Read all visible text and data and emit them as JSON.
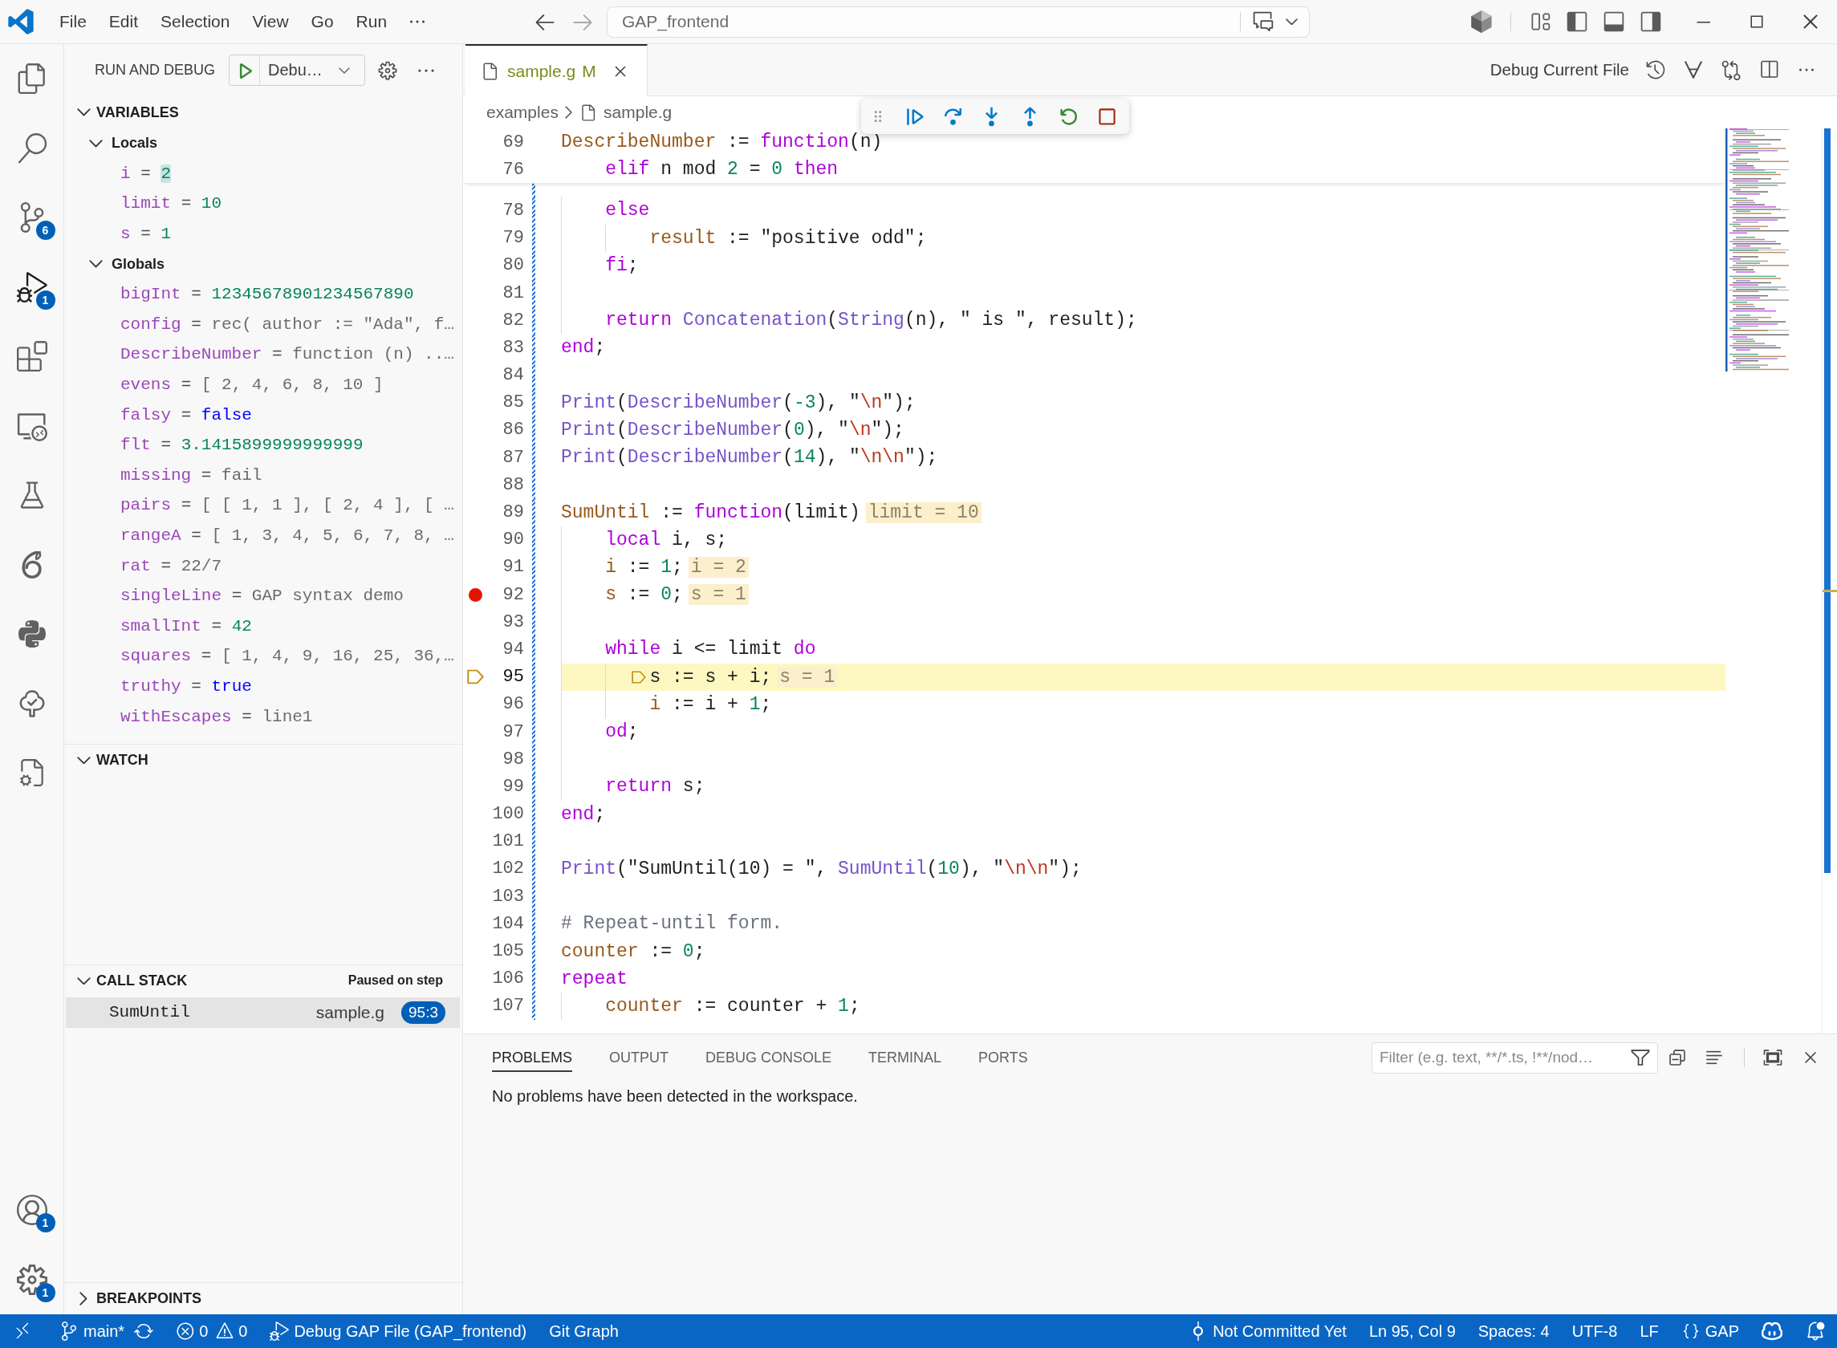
{
  "title_bar": {
    "menu": [
      {
        "label": "File"
      },
      {
        "label": "Edit"
      },
      {
        "label": "Selection"
      },
      {
        "label": "View"
      },
      {
        "label": "Go"
      },
      {
        "label": "Run"
      }
    ],
    "command_center": {
      "value": "GAP_frontend"
    }
  },
  "activity_bar": {
    "items": [
      {
        "selected": false
      },
      {
        "selected": false
      },
      {
        "selected": false,
        "badge": "6"
      },
      {
        "selected": true,
        "badge": "1"
      },
      {
        "selected": false
      },
      {
        "selected": false
      },
      {
        "selected": false
      },
      {
        "selected": false
      },
      {
        "selected": false
      },
      {
        "selected": false
      },
      {
        "selected": false
      }
    ],
    "bottom": [
      {
        "badge": "1"
      },
      {
        "badge": "1"
      }
    ]
  },
  "sidebar": {
    "title": "RUN AND DEBUG",
    "configuration": "Debu…",
    "variables": {
      "title": "VARIABLES",
      "expanded": true,
      "scopes": [
        {
          "name": "Locals",
          "expanded": true,
          "items": [
            {
              "name": "i",
              "separator": "=",
              "value": "2",
              "kind": "number",
              "changed": true
            },
            {
              "name": "limit",
              "separator": "=",
              "value": "10",
              "kind": "number",
              "changed": false
            },
            {
              "name": "s",
              "separator": "=",
              "value": "1",
              "kind": "number",
              "changed": false
            }
          ]
        },
        {
          "name": "Globals",
          "expanded": true,
          "items": [
            {
              "name": "bigInt",
              "separator": "=",
              "value": "12345678901234567890",
              "kind": "number",
              "changed": false
            },
            {
              "name": "config",
              "separator": "=",
              "value": "rec( author := \"Ada\", f…",
              "kind": "text",
              "changed": false
            },
            {
              "name": "DescribeNumber",
              "separator": "=",
              "value": "function (n) ..…",
              "kind": "text",
              "changed": false
            },
            {
              "name": "evens",
              "separator": "=",
              "value": "[ 2, 4, 6, 8, 10 ]",
              "kind": "text",
              "changed": false
            },
            {
              "name": "falsy",
              "separator": "=",
              "value": "false",
              "kind": "boolean",
              "changed": false
            },
            {
              "name": "flt",
              "separator": "=",
              "value": "3.1415899999999999",
              "kind": "number",
              "changed": false
            },
            {
              "name": "missing",
              "separator": "=",
              "value": "fail",
              "kind": "text",
              "changed": false
            },
            {
              "name": "pairs",
              "separator": "=",
              "value": "[ [ 1, 1 ], [ 2, 4 ], [ …",
              "kind": "text",
              "changed": false
            },
            {
              "name": "rangeA",
              "separator": "=",
              "value": "[ 1, 3, 4, 5, 6, 7, 8, …",
              "kind": "text",
              "changed": false
            },
            {
              "name": "rat",
              "separator": "=",
              "value": "22/7",
              "kind": "text",
              "changed": false
            },
            {
              "name": "singleLine",
              "separator": "=",
              "value": "GAP syntax demo",
              "kind": "text",
              "changed": false
            },
            {
              "name": "smallInt",
              "separator": "=",
              "value": "42",
              "kind": "number",
              "changed": false
            },
            {
              "name": "squares",
              "separator": "=",
              "value": "[ 1, 4, 9, 16, 25, 36,…",
              "kind": "text",
              "changed": false
            },
            {
              "name": "truthy",
              "separator": "=",
              "value": "true",
              "kind": "boolean",
              "changed": false
            },
            {
              "name": "withEscapes",
              "separator": "=",
              "value": "line1",
              "kind": "text",
              "changed": false
            }
          ]
        }
      ]
    },
    "watch": {
      "title": "WATCH",
      "expanded": true
    },
    "call_stack": {
      "title": "CALL STACK",
      "expanded": true,
      "status": "Paused on step",
      "frames": [
        {
          "name": "SumUntil",
          "file": "sample.g",
          "position": "95:3",
          "selected": true
        }
      ]
    },
    "breakpoints": {
      "title": "BREAKPOINTS",
      "expanded": false
    }
  },
  "editor": {
    "tabs": [
      {
        "label": "sample.g",
        "status": "M",
        "selected": true
      }
    ],
    "debug_action": "Debug Current File",
    "breadcrumb": [
      "examples",
      "sample.g"
    ],
    "sticky_lines": [
      {
        "number": "69",
        "tokens": [
          {
            "kind": "definition",
            "text": "DescribeNumber"
          },
          {
            "kind": "plain",
            "text": " := "
          },
          {
            "kind": "keyword",
            "text": "function"
          },
          {
            "kind": "plain",
            "text": "(n)"
          }
        ]
      },
      {
        "number": "76",
        "tokens": [
          {
            "kind": "keyword",
            "text": "    elif"
          },
          {
            "kind": "plain",
            "text": " n mod "
          },
          {
            "kind": "number",
            "text": "2"
          },
          {
            "kind": "plain",
            "text": " = "
          },
          {
            "kind": "number",
            "text": "0"
          },
          {
            "kind": "keyword",
            "text": " then"
          }
        ]
      }
    ],
    "lines": [
      {
        "number": "78",
        "tokens": [
          {
            "kind": "keyword",
            "text": "    else"
          }
        ],
        "added": true,
        "breakpoint": false,
        "current": false
      },
      {
        "number": "79",
        "tokens": [
          {
            "kind": "definition",
            "text": "        result"
          },
          {
            "kind": "plain",
            "text": " := \"positive odd\";"
          }
        ],
        "added": true,
        "breakpoint": false,
        "current": false
      },
      {
        "number": "80",
        "tokens": [
          {
            "kind": "keyword",
            "text": "    fi"
          },
          {
            "kind": "plain",
            "text": ";"
          }
        ],
        "added": true,
        "breakpoint": false,
        "current": false
      },
      {
        "number": "81",
        "added": true,
        "breakpoint": false,
        "current": false
      },
      {
        "number": "82",
        "tokens": [
          {
            "kind": "keyword",
            "text": "    return"
          },
          {
            "kind": "call",
            "text": " Concatenation"
          },
          {
            "kind": "plain",
            "text": "("
          },
          {
            "kind": "call",
            "text": "String"
          },
          {
            "kind": "plain",
            "text": "(n), \" is \", result);"
          }
        ],
        "added": true,
        "breakpoint": false,
        "current": false
      },
      {
        "number": "83",
        "tokens": [
          {
            "kind": "keyword",
            "text": "end"
          },
          {
            "kind": "plain",
            "text": ";"
          }
        ],
        "added": true,
        "breakpoint": false,
        "current": false
      },
      {
        "number": "84",
        "added": true,
        "breakpoint": false,
        "current": false
      },
      {
        "number": "85",
        "tokens": [
          {
            "kind": "call",
            "text": "Print"
          },
          {
            "kind": "plain",
            "text": "("
          },
          {
            "kind": "call",
            "text": "DescribeNumber"
          },
          {
            "kind": "plain",
            "text": "("
          },
          {
            "kind": "number",
            "text": "-3"
          },
          {
            "kind": "plain",
            "text": "), \""
          },
          {
            "kind": "escape",
            "text": "\\n"
          },
          {
            "kind": "plain",
            "text": "\");"
          }
        ],
        "added": true,
        "breakpoint": false,
        "current": false
      },
      {
        "number": "86",
        "tokens": [
          {
            "kind": "call",
            "text": "Print"
          },
          {
            "kind": "plain",
            "text": "("
          },
          {
            "kind": "call",
            "text": "DescribeNumber"
          },
          {
            "kind": "plain",
            "text": "("
          },
          {
            "kind": "number",
            "text": "0"
          },
          {
            "kind": "plain",
            "text": "), \""
          },
          {
            "kind": "escape",
            "text": "\\n"
          },
          {
            "kind": "plain",
            "text": "\");"
          }
        ],
        "added": true,
        "breakpoint": false,
        "current": false
      },
      {
        "number": "87",
        "tokens": [
          {
            "kind": "call",
            "text": "Print"
          },
          {
            "kind": "plain",
            "text": "("
          },
          {
            "kind": "call",
            "text": "DescribeNumber"
          },
          {
            "kind": "plain",
            "text": "("
          },
          {
            "kind": "number",
            "text": "14"
          },
          {
            "kind": "plain",
            "text": "), \""
          },
          {
            "kind": "escape",
            "text": "\\n\\n"
          },
          {
            "kind": "plain",
            "text": "\");"
          }
        ],
        "added": true,
        "breakpoint": false,
        "current": false
      },
      {
        "number": "88",
        "added": true,
        "breakpoint": false,
        "current": false
      },
      {
        "number": "89",
        "tokens": [
          {
            "kind": "definition",
            "text": "SumUntil"
          },
          {
            "kind": "plain",
            "text": " := "
          },
          {
            "kind": "keyword",
            "text": "function"
          },
          {
            "kind": "plain",
            "text": "(limit)"
          }
        ],
        "inline_value": "limit = 10",
        "added": true,
        "breakpoint": false,
        "current": false
      },
      {
        "number": "90",
        "tokens": [
          {
            "kind": "keyword",
            "text": "    local"
          },
          {
            "kind": "plain",
            "text": " i, s;"
          }
        ],
        "added": true,
        "breakpoint": false,
        "current": false
      },
      {
        "number": "91",
        "tokens": [
          {
            "kind": "definition",
            "text": "    i"
          },
          {
            "kind": "plain",
            "text": " := "
          },
          {
            "kind": "number",
            "text": "1"
          },
          {
            "kind": "plain",
            "text": ";"
          }
        ],
        "inline_value": "i = 2",
        "added": true,
        "breakpoint": false,
        "current": false
      },
      {
        "number": "92",
        "tokens": [
          {
            "kind": "definition",
            "text": "    s"
          },
          {
            "kind": "plain",
            "text": " := "
          },
          {
            "kind": "number",
            "text": "0"
          },
          {
            "kind": "plain",
            "text": ";"
          }
        ],
        "inline_value": "s = 1",
        "added": true,
        "breakpoint": true,
        "current": false
      },
      {
        "number": "93",
        "added": true,
        "breakpoint": false,
        "current": false
      },
      {
        "number": "94",
        "tokens": [
          {
            "kind": "keyword",
            "text": "    while"
          },
          {
            "kind": "plain",
            "text": " i <= limit "
          },
          {
            "kind": "keyword",
            "text": "do"
          }
        ],
        "added": true,
        "breakpoint": false,
        "current": false
      },
      {
        "number": "95",
        "tokens": [
          {
            "kind": "plain",
            "text": "        s := s + i;"
          }
        ],
        "inline_value": "s = 1",
        "added": true,
        "breakpoint": false,
        "current": true
      },
      {
        "number": "96",
        "tokens": [
          {
            "kind": "definition",
            "text": "        i"
          },
          {
            "kind": "plain",
            "text": " := i + "
          },
          {
            "kind": "number",
            "text": "1"
          },
          {
            "kind": "plain",
            "text": ";"
          }
        ],
        "added": true,
        "breakpoint": false,
        "current": false
      },
      {
        "number": "97",
        "tokens": [
          {
            "kind": "keyword",
            "text": "    od"
          },
          {
            "kind": "plain",
            "text": ";"
          }
        ],
        "added": true,
        "breakpoint": false,
        "current": false
      },
      {
        "number": "98",
        "added": true,
        "breakpoint": false,
        "current": false
      },
      {
        "number": "99",
        "tokens": [
          {
            "kind": "keyword",
            "text": "    return"
          },
          {
            "kind": "plain",
            "text": " s;"
          }
        ],
        "added": true,
        "breakpoint": false,
        "current": false
      },
      {
        "number": "100",
        "tokens": [
          {
            "kind": "keyword",
            "text": "end"
          },
          {
            "kind": "plain",
            "text": ";"
          }
        ],
        "added": true,
        "breakpoint": false,
        "current": false
      },
      {
        "number": "101",
        "added": true,
        "breakpoint": false,
        "current": false
      },
      {
        "number": "102",
        "tokens": [
          {
            "kind": "call",
            "text": "Print"
          },
          {
            "kind": "plain",
            "text": "(\"SumUntil(10) = \", "
          },
          {
            "kind": "call",
            "text": "SumUntil"
          },
          {
            "kind": "plain",
            "text": "("
          },
          {
            "kind": "number",
            "text": "10"
          },
          {
            "kind": "plain",
            "text": "), \""
          },
          {
            "kind": "escape",
            "text": "\\n\\n"
          },
          {
            "kind": "plain",
            "text": "\");"
          }
        ],
        "added": true,
        "breakpoint": false,
        "current": false
      },
      {
        "number": "103",
        "added": true,
        "breakpoint": false,
        "current": false
      },
      {
        "number": "104",
        "tokens": [
          {
            "kind": "comment",
            "text": "# Repeat-until form."
          }
        ],
        "added": true,
        "breakpoint": false,
        "current": false
      },
      {
        "number": "105",
        "tokens": [
          {
            "kind": "definition",
            "text": "counter"
          },
          {
            "kind": "plain",
            "text": " := "
          },
          {
            "kind": "number",
            "text": "0"
          },
          {
            "kind": "plain",
            "text": ";"
          }
        ],
        "added": true,
        "breakpoint": false,
        "current": false
      },
      {
        "number": "106",
        "tokens": [
          {
            "kind": "keyword",
            "text": "repeat"
          }
        ],
        "added": true,
        "breakpoint": false,
        "current": false
      },
      {
        "number": "107",
        "tokens": [
          {
            "kind": "definition",
            "text": "    counter"
          },
          {
            "kind": "plain",
            "text": " := counter + "
          },
          {
            "kind": "number",
            "text": "1"
          },
          {
            "kind": "plain",
            "text": ";"
          }
        ],
        "added": true,
        "breakpoint": false,
        "current": false
      }
    ]
  },
  "panel": {
    "tabs": [
      {
        "label": "PROBLEMS",
        "selected": true
      },
      {
        "label": "OUTPUT",
        "selected": false
      },
      {
        "label": "DEBUG CONSOLE",
        "selected": false
      },
      {
        "label": "TERMINAL",
        "selected": false
      },
      {
        "label": "PORTS",
        "selected": false
      }
    ],
    "filter": {
      "placeholder": "Filter (e.g. text, **/*.ts, !**/nod…"
    },
    "message": "No problems have been detected in the workspace."
  },
  "status_bar": {
    "branch": "main*",
    "errors": "0",
    "warnings": "0",
    "debug_target": "Debug GAP File (GAP_frontend)",
    "git_graph": "Git Graph",
    "blame": "Not Committed Yet",
    "cursor": "Ln 95, Col 9",
    "indentation": "Spaces: 4",
    "encoding": "UTF-8",
    "line_ending": "LF",
    "language": "GAP"
  }
}
